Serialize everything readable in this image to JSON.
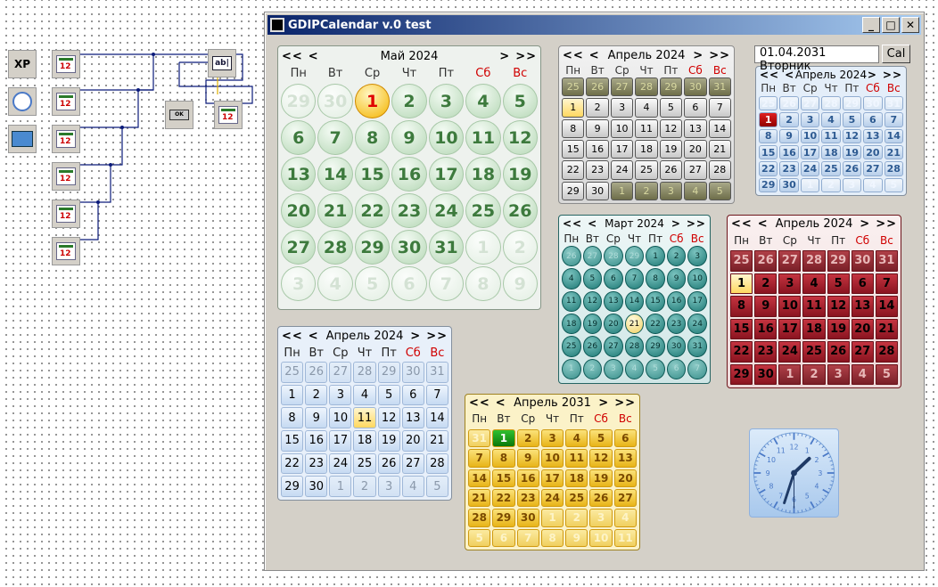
{
  "window": {
    "title": "GDIPCalendar v.0 test",
    "min": "_",
    "max": "□",
    "close": "✕"
  },
  "designer": {
    "xp_label": "XP",
    "button_label": "OK",
    "edit_label": "ab|"
  },
  "nav": {
    "prev_year": "<<",
    "prev_month": "<",
    "next_month": ">",
    "next_year": ">>"
  },
  "date_field": {
    "value": "01.04.2031 Вторник",
    "button": "Cal"
  },
  "calendars": [
    {
      "name": "green",
      "month": "Май 2024",
      "weekdays": [
        "Пн",
        "Вт",
        "Ср",
        "Чт",
        "Пт",
        "Сб",
        "Вс"
      ],
      "selected": "1",
      "days": [
        "29",
        "30",
        "1",
        "2",
        "3",
        "4",
        "5",
        "6",
        "7",
        "8",
        "9",
        "10",
        "11",
        "12",
        "13",
        "14",
        "15",
        "16",
        "17",
        "18",
        "19",
        "20",
        "21",
        "22",
        "23",
        "24",
        "25",
        "26",
        "27",
        "28",
        "29",
        "30",
        "31",
        "1",
        "2",
        "3",
        "4",
        "5",
        "6",
        "7",
        "8",
        "9"
      ],
      "first_current": 2,
      "current_count": 31,
      "colors": {
        "face": "#eef2ee",
        "cell": "#cfe6cf",
        "text": "#2e6b2e",
        "sel": "#ffc800"
      }
    },
    {
      "name": "black",
      "month": "Апрель 2024",
      "weekdays": [
        "Пн",
        "Вт",
        "Ср",
        "Чт",
        "Пт",
        "Сб",
        "Вс"
      ],
      "selected": "1",
      "days": [
        "25",
        "26",
        "27",
        "28",
        "29",
        "30",
        "31",
        "1",
        "2",
        "3",
        "4",
        "5",
        "6",
        "7",
        "8",
        "9",
        "10",
        "11",
        "12",
        "13",
        "14",
        "15",
        "16",
        "17",
        "18",
        "19",
        "20",
        "21",
        "22",
        "23",
        "24",
        "25",
        "26",
        "27",
        "28",
        "29",
        "30",
        "1",
        "2",
        "3",
        "4",
        "5"
      ],
      "first_current": 7,
      "current_count": 30,
      "colors": {
        "face": "#e8e8e8",
        "cell": "#d8d8d8",
        "text": "#000000",
        "sel": "#ffd24a"
      }
    },
    {
      "name": "lightblue",
      "month": "Апрель 2024",
      "weekdays": [
        "Пн",
        "Вт",
        "Ср",
        "Чт",
        "Пт",
        "Сб",
        "Вс"
      ],
      "selected": "1",
      "days": [
        "25",
        "26",
        "27",
        "28",
        "29",
        "30",
        "31",
        "1",
        "2",
        "3",
        "4",
        "5",
        "6",
        "7",
        "8",
        "9",
        "10",
        "11",
        "12",
        "13",
        "14",
        "15",
        "16",
        "17",
        "18",
        "19",
        "20",
        "21",
        "22",
        "23",
        "24",
        "25",
        "26",
        "27",
        "28",
        "29",
        "30",
        "1",
        "2",
        "3",
        "4",
        "5"
      ],
      "first_current": 7,
      "current_count": 30,
      "colors": {
        "face": "#e4eef9",
        "cell": "#cadcf2",
        "text": "#2d5a91",
        "sel": "#c00000"
      }
    },
    {
      "name": "teal",
      "month": "Март 2024",
      "weekdays": [
        "Пн",
        "Вт",
        "Ср",
        "Чт",
        "Пт",
        "Сб",
        "Вс"
      ],
      "selected": "21",
      "days": [
        "26",
        "27",
        "28",
        "29",
        "1",
        "2",
        "3",
        "4",
        "5",
        "6",
        "7",
        "8",
        "9",
        "10",
        "11",
        "12",
        "13",
        "14",
        "15",
        "16",
        "17",
        "18",
        "19",
        "20",
        "21",
        "22",
        "23",
        "24",
        "25",
        "26",
        "27",
        "28",
        "29",
        "30",
        "31",
        "1",
        "2",
        "3",
        "4",
        "5",
        "6",
        "7"
      ],
      "first_current": 4,
      "current_count": 31,
      "colors": {
        "face": "#d6ecec",
        "cell": "#3a9c98",
        "text": "#0b3b3a",
        "sel": "#ffe880"
      }
    },
    {
      "name": "red",
      "month": "Апрель 2024",
      "weekdays": [
        "Пн",
        "Вт",
        "Ср",
        "Чт",
        "Пт",
        "Сб",
        "Вс"
      ],
      "selected": "1",
      "days": [
        "25",
        "26",
        "27",
        "28",
        "29",
        "30",
        "31",
        "1",
        "2",
        "3",
        "4",
        "5",
        "6",
        "7",
        "8",
        "9",
        "10",
        "11",
        "12",
        "13",
        "14",
        "15",
        "16",
        "17",
        "18",
        "19",
        "20",
        "21",
        "22",
        "23",
        "24",
        "25",
        "26",
        "27",
        "28",
        "29",
        "30",
        "1",
        "2",
        "3",
        "4",
        "5"
      ],
      "first_current": 7,
      "current_count": 30,
      "colors": {
        "face": "#f4e2e2",
        "cell": "#a8202a",
        "text": "#000000",
        "sel": "#ffe89a"
      }
    },
    {
      "name": "blue",
      "month": "Апрель 2024",
      "weekdays": [
        "Пн",
        "Вт",
        "Ср",
        "Чт",
        "Пт",
        "Сб",
        "Вс"
      ],
      "selected": "11",
      "days": [
        "25",
        "26",
        "27",
        "28",
        "29",
        "30",
        "31",
        "1",
        "2",
        "3",
        "4",
        "5",
        "6",
        "7",
        "8",
        "9",
        "10",
        "11",
        "12",
        "13",
        "14",
        "15",
        "16",
        "17",
        "18",
        "19",
        "20",
        "21",
        "22",
        "23",
        "24",
        "25",
        "26",
        "27",
        "28",
        "29",
        "30",
        "1",
        "2",
        "3",
        "4",
        "5"
      ],
      "first_current": 7,
      "current_count": 30,
      "colors": {
        "face": "#e8f0fa",
        "cell": "#c9dcf2",
        "text": "#000000",
        "sel": "#ffe08a"
      }
    },
    {
      "name": "yellow",
      "month": "Апрель 2031",
      "weekdays": [
        "Пн",
        "Вт",
        "Ср",
        "Чт",
        "Пт",
        "Сб",
        "Вс"
      ],
      "selected": "1",
      "days": [
        "31",
        "1",
        "2",
        "3",
        "4",
        "5",
        "6",
        "7",
        "8",
        "9",
        "10",
        "11",
        "12",
        "13",
        "14",
        "15",
        "16",
        "17",
        "18",
        "19",
        "20",
        "21",
        "22",
        "23",
        "24",
        "25",
        "26",
        "27",
        "28",
        "29",
        "30",
        "1",
        "2",
        "3",
        "4",
        "5",
        "6",
        "7",
        "8",
        "9",
        "10",
        "11"
      ],
      "first_current": 1,
      "current_count": 30,
      "colors": {
        "face": "#fbf2c8",
        "cell": "#f4c832",
        "text": "#7a4a00",
        "sel": "#169c16"
      }
    }
  ],
  "clock": {
    "hour": 1,
    "minute": 33,
    "second": 30
  }
}
